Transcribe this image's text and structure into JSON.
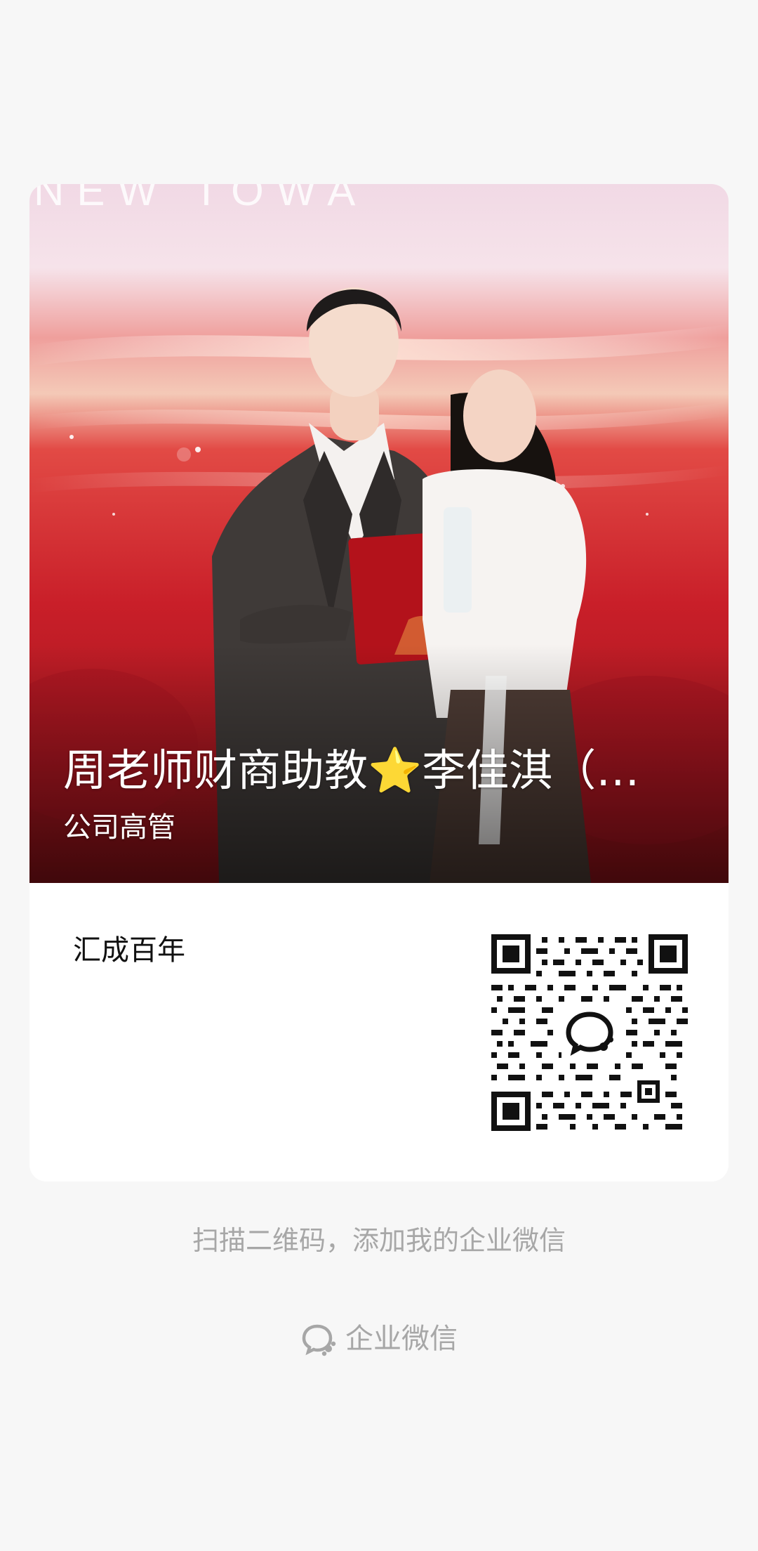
{
  "profile": {
    "name": "周老师财商助教⭐李佳淇（…",
    "title": "公司高管"
  },
  "company": {
    "name": "汇成百年"
  },
  "photo": {
    "banner_text": "NEW TOWA"
  },
  "qr": {
    "center_icon": "wecom-logo-icon"
  },
  "footer": {
    "hint": "扫描二维码，添加我的企业微信",
    "brand": "企业微信",
    "brand_icon": "wecom-logo-icon"
  },
  "colors": {
    "background": "#f7f7f7",
    "card": "#ffffff",
    "muted_text": "#a7a7a7",
    "photo_red": "#c8202a"
  }
}
